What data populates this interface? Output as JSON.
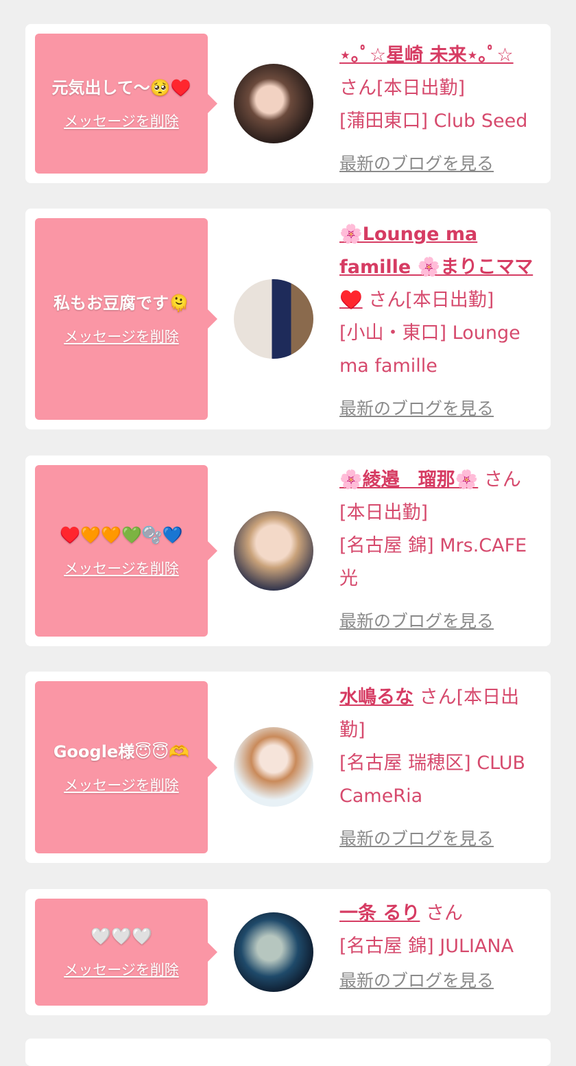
{
  "delete_label": "メッセージを削除",
  "blog_label": "最新のブログを見る",
  "colors": {
    "bubble": "#fa96a5",
    "accent": "#d64a6d",
    "background": "#efefef"
  },
  "items": [
    {
      "message": "元気出して〜🥺♥️",
      "name": "⋆｡ﾟ☆星崎 未来⋆｡ﾟ☆",
      "suffix": "さん[本日出勤]",
      "store": "[蒲田東口] Club Seed"
    },
    {
      "message": "私もお豆腐です🫠",
      "name": "🌸Lounge ma famille 🌸まりこママ♥️",
      "suffix": "さん[本日出勤]",
      "store": "[小山・東口] Lounge ma famille"
    },
    {
      "message": "♥️🧡🧡💚🫧💙",
      "name": "🌸綾邉　瑠那🌸",
      "suffix": "さん[本日出勤]",
      "store": "[名古屋 錦] Mrs.CAFE 光"
    },
    {
      "message": "Google様😇😇🫶",
      "name": "水嶋るな",
      "suffix": "さん[本日出勤]",
      "store": "[名古屋 瑞穂区] CLUB CameRia"
    },
    {
      "message": "🤍🤍🤍",
      "name": "一条 るり",
      "suffix": "さん",
      "store": "[名古屋 錦] JULIANA"
    }
  ]
}
